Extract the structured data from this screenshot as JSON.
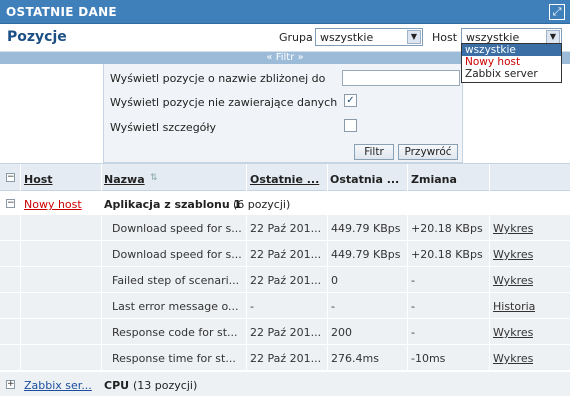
{
  "titlebar": {
    "title": "OSTATNIE DANE"
  },
  "header": {
    "page_title": "Pozycje",
    "group_label": "Grupa",
    "group_value": "wszystkie",
    "host_label": "Host",
    "host_value": "wszystkie",
    "host_options": [
      "wszystkie",
      "Nowy host",
      "Zabbix server"
    ]
  },
  "filter": {
    "toggle_label": "« Filtr »",
    "name_like_label": "Wyświetl pozycje o nazwie zbliżonej do",
    "name_like_value": "",
    "no_data_label": "Wyświetl pozycje nie zawierające danych",
    "no_data_checked": true,
    "details_label": "Wyświetl szczegóły",
    "details_checked": false,
    "filter_button": "Filtr",
    "reset_button": "Przywróć"
  },
  "table": {
    "columns": [
      "Host",
      "Nazwa",
      "Ostatnie ...",
      "Ostatnia ...",
      "Zmiana"
    ],
    "groups": [
      {
        "host": "Nowy host",
        "expand_symbol": "−",
        "app_name": "Aplikacja z szablonu 1",
        "app_count": "(6 pozycji)",
        "rows": [
          {
            "name": "Download speed for s...",
            "last_check": "22 Paź 201...",
            "last_value": "449.79 KBps",
            "change": "+20.18 KBps",
            "action": "Wykres"
          },
          {
            "name": "Download speed for s...",
            "last_check": "22 Paź 201...",
            "last_value": "449.79 KBps",
            "change": "+20.18 KBps",
            "action": "Wykres"
          },
          {
            "name": "Failed step of scenari...",
            "last_check": "22 Paź 201...",
            "last_value": "0",
            "change": "-",
            "action": "Wykres"
          },
          {
            "name": "Last error message o...",
            "last_check": "-",
            "last_value": "-",
            "change": "-",
            "action": "Historia"
          },
          {
            "name": "Response code for st...",
            "last_check": "22 Paź 201...",
            "last_value": "200",
            "change": "-",
            "action": "Wykres"
          },
          {
            "name": "Response time for st...",
            "last_check": "22 Paź 201...",
            "last_value": "276.4ms",
            "change": "-10ms",
            "action": "Wykres"
          }
        ]
      },
      {
        "host": "Zabbix ser...",
        "expand_symbol": "+",
        "app_name": "CPU",
        "app_count": "(13 pozycji)",
        "rows": []
      }
    ]
  }
}
